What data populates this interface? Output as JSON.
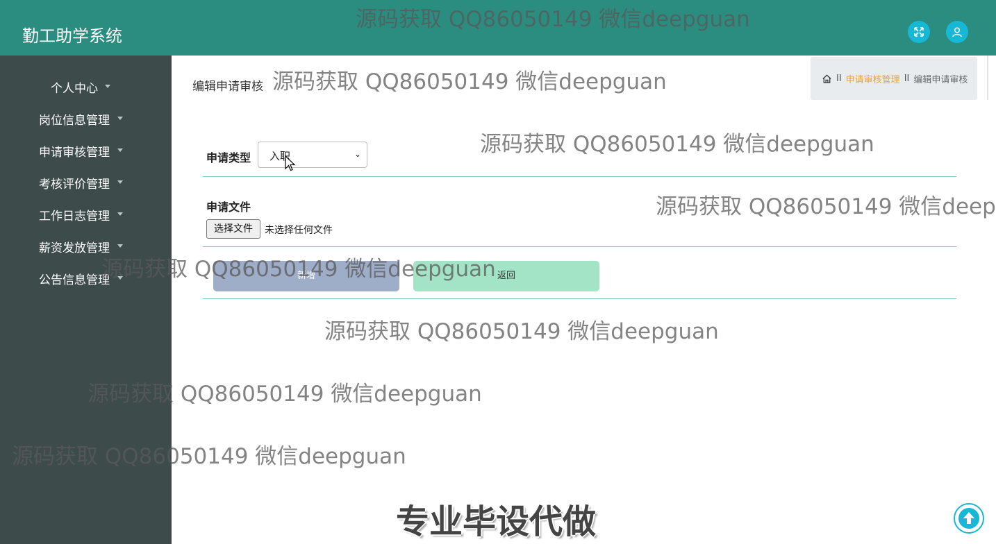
{
  "app": {
    "title": "勤工助学系统"
  },
  "header_icons": [
    "fullscreen-icon",
    "user-icon"
  ],
  "sidebar": {
    "items": [
      {
        "label": "个人中心"
      },
      {
        "label": "岗位信息管理"
      },
      {
        "label": "申请审核管理"
      },
      {
        "label": "考核评价管理"
      },
      {
        "label": "工作日志管理"
      },
      {
        "label": "薪资发放管理"
      },
      {
        "label": "公告信息管理"
      }
    ]
  },
  "page": {
    "title": "编辑申请审核"
  },
  "breadcrumb": {
    "sep": "II",
    "parent": "申请审核管理",
    "current": "编辑申请审核"
  },
  "form": {
    "type_label": "申请类型",
    "type_value": "入职",
    "file_label": "申请文件",
    "file_button": "选择文件",
    "file_status": "未选择任何文件",
    "add_label": "新增",
    "back_label": "返回"
  },
  "watermark": "源码获取 QQ86050149 微信deepguan",
  "promo": "专业毕设代做",
  "colors": {
    "header": "#2a8d80",
    "sidebar": "#3e4b4b",
    "accent_cyan": "#16b8d6",
    "breadcrumb_link": "#e5a23c",
    "add_button": "#9faec8",
    "back_button": "#a4e4c6",
    "divider": "#87c9c2"
  }
}
